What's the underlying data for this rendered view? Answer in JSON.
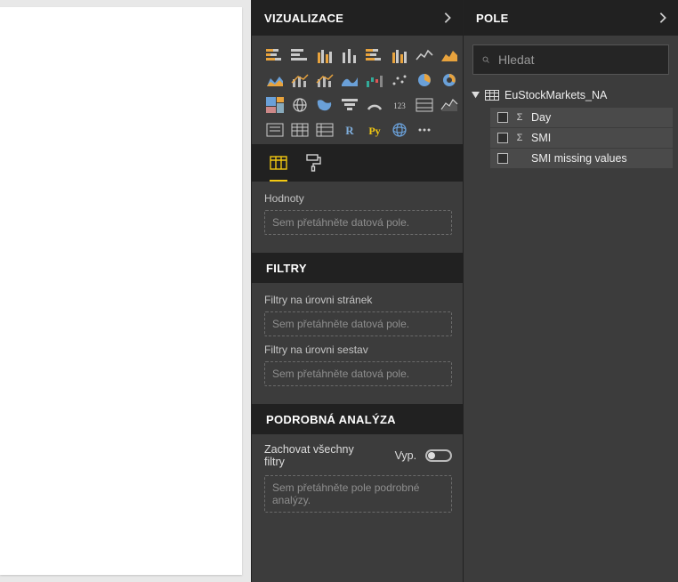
{
  "viz_panel": {
    "title": "VIZUALIZACE",
    "values_label": "Hodnoty",
    "values_placeholder": "Sem přetáhněte datová pole.",
    "filters_title": "FILTRY",
    "filter_page_label": "Filtry na úrovni stránek",
    "filter_page_placeholder": "Sem přetáhněte datová pole.",
    "filter_report_label": "Filtry na úrovni sestav",
    "filter_report_placeholder": "Sem přetáhněte datová pole.",
    "drill_title": "PODROBNÁ ANALÝZA",
    "keep_filters_label": "Zachovat všechny filtry",
    "toggle_state": "Vyp.",
    "drill_placeholder": "Sem přetáhněte pole podrobné analýzy."
  },
  "viz_icons": [
    "stacked-bar",
    "clustered-bar",
    "stacked-column",
    "clustered-column",
    "stacked-bar-100",
    "stacked-column-100",
    "line",
    "area",
    "stacked-area",
    "line-column",
    "line-clustered",
    "ribbon",
    "waterfall",
    "scatter",
    "pie",
    "donut",
    "treemap",
    "map",
    "filled-map",
    "funnel",
    "gauge",
    "card",
    "multi-row-card",
    "kpi",
    "slicer",
    "table",
    "matrix",
    "r-visual",
    "py-visual",
    "arcgis",
    "more"
  ],
  "fields_panel": {
    "title": "POLE",
    "search_placeholder": "Hledat",
    "table": "EuStockMarkets_NA",
    "fields": [
      {
        "name": "Day",
        "sigma": true
      },
      {
        "name": "SMI",
        "sigma": true
      },
      {
        "name": "SMI missing values",
        "sigma": false
      }
    ]
  }
}
